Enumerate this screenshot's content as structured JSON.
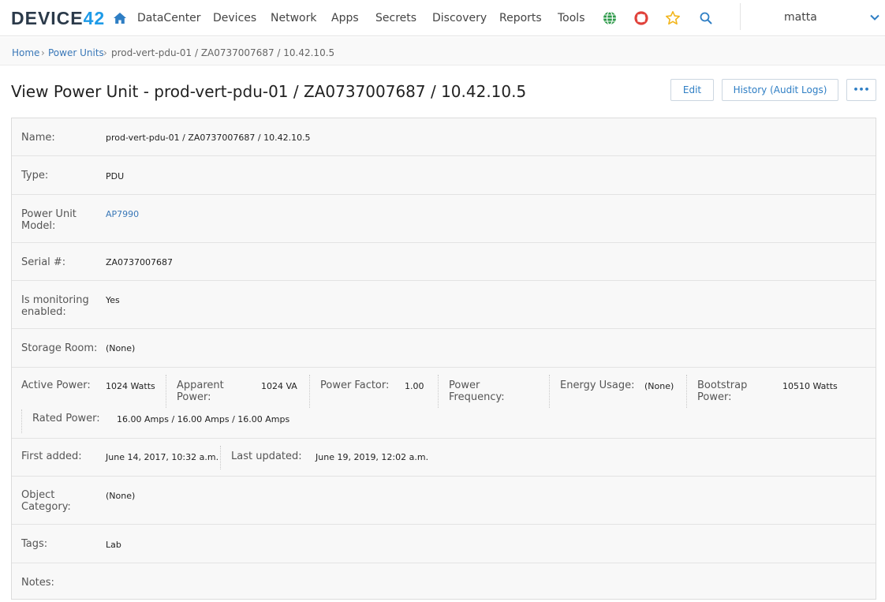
{
  "nav": {
    "logo_main": "DEVICE",
    "logo_num": "42",
    "items": [
      "DataCenter",
      "Devices",
      "Network",
      "Apps",
      "Secrets",
      "Discovery",
      "Reports",
      "Tools"
    ],
    "username": "matta"
  },
  "breadcrumb": {
    "home": "Home",
    "section": "Power Units",
    "current": "prod-vert-pdu-01 / ZA0737007687 / 10.42.10.5",
    "sep": "›"
  },
  "page": {
    "title": "View Power Unit - prod-vert-pdu-01 / ZA0737007687 / 10.42.10.5",
    "edit_label": "Edit",
    "history_label": "History (Audit Logs)",
    "more_label": "•••"
  },
  "fields": {
    "name_label": "Name:",
    "name_value": "prod-vert-pdu-01 / ZA0737007687 / 10.42.10.5",
    "type_label": "Type:",
    "type_value": "PDU",
    "model_label_1": "Power Unit",
    "model_label_2": "Model:",
    "model_value": "AP7990",
    "serial_label": "Serial #:",
    "serial_value": "ZA0737007687",
    "monitor_label_1": "Is monitoring",
    "monitor_label_2": "enabled:",
    "monitor_value": "Yes",
    "storage_label": "Storage Room:",
    "storage_value": "(None)",
    "active_label": "Active Power:",
    "active_value": "1024 Watts",
    "apparent_label_1": "Apparent",
    "apparent_label_2": "Power:",
    "apparent_value": "1024 VA",
    "pf_label": "Power Factor:",
    "pf_value": "1.00",
    "freq_label_1": "Power",
    "freq_label_2": "Frequency:",
    "energy_label": "Energy Usage:",
    "energy_value": "(None)",
    "boot_label_1": "Bootstrap",
    "boot_label_2": "Power:",
    "boot_value": "10510 Watts",
    "rated_label": "Rated Power:",
    "rated_value": "16.00 Amps / 16.00 Amps / 16.00 Amps",
    "first_label": "First added:",
    "first_value": "June 14, 2017, 10:32 a.m.",
    "updated_label": "Last updated:",
    "updated_value": "June 19, 2019, 12:02 a.m.",
    "category_label_1": "Object",
    "category_label_2": "Category:",
    "category_value": "(None)",
    "tags_label": "Tags:",
    "tags_value": "Lab",
    "notes_label": "Notes:"
  },
  "colors": {
    "accent": "#2e7ec4",
    "link": "#3a78b8",
    "logo_num": "#1e9be8",
    "globe": "#2e9a4a",
    "lifebuoy": "#e0413a",
    "star": "#f2b51b"
  }
}
